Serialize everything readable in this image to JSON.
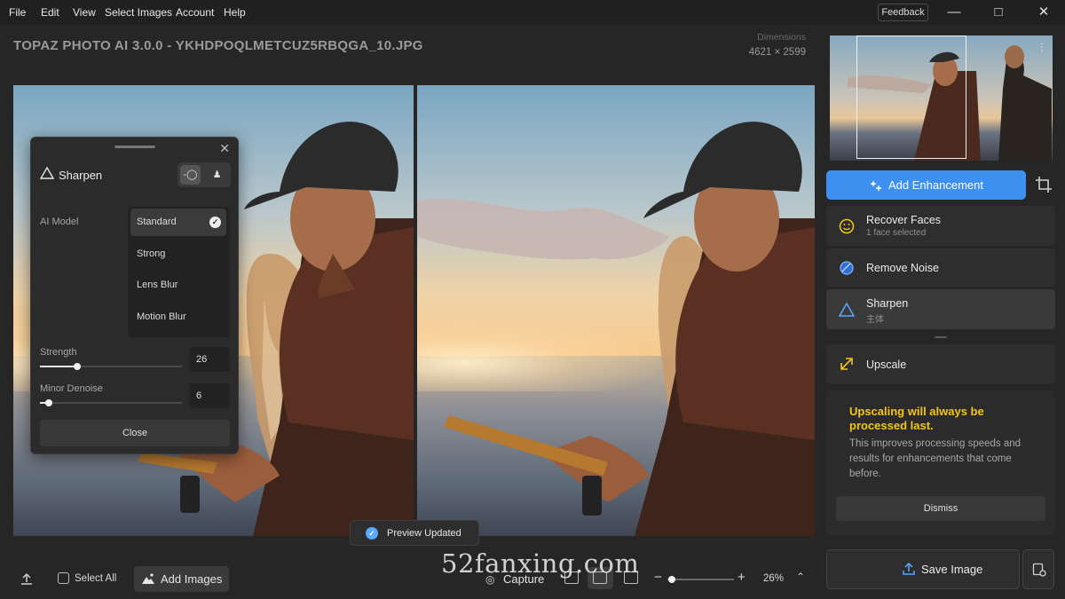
{
  "menu": [
    "File",
    "Edit",
    "View",
    "Select Images",
    "Account",
    "Help"
  ],
  "feedback_label": "Feedback",
  "file_title": "TOPAZ PHOTO AI 3.0.0 - YKHDPOQLMETCUZ5RBQGA_10.JPG",
  "dimensions": {
    "label": "Dimensions",
    "value": "4621 × 2599"
  },
  "sharpen_panel": {
    "title": "Sharpen",
    "ai_model_label": "AI Model",
    "models": [
      "Standard",
      "Strong",
      "Lens Blur",
      "Motion Blur"
    ],
    "selected_model": "Standard",
    "strength": {
      "label": "Strength",
      "value": "26",
      "fraction": 0.26
    },
    "minor_denoise": {
      "label": "Minor Denoise",
      "value": "6",
      "fraction": 0.06
    },
    "close_label": "Close"
  },
  "toast": {
    "text": "Preview Updated"
  },
  "bottom_bar": {
    "select_all": "Select All",
    "add_images": "Add Images",
    "capture": "Capture",
    "zoom": "26%",
    "zoom_fraction": 0.07
  },
  "watermark": "52fanxing.com",
  "sidebar": {
    "add_enhancement": "Add Enhancement",
    "enhancements": [
      {
        "title": "Recover Faces",
        "subtitle": "1 face selected",
        "icon": "smile-icon"
      },
      {
        "title": "Remove Noise",
        "subtitle": "",
        "icon": "noise-icon"
      },
      {
        "title": "Sharpen",
        "subtitle": "主体",
        "icon": "triangle-icon"
      },
      {
        "title": "Upscale",
        "subtitle": "",
        "icon": "upscale-arrow-icon"
      }
    ],
    "upscale_note": {
      "title": "Upscaling will always be processed last.",
      "body": "This improves processing speeds and results for enhancements that come before.",
      "dismiss": "Dismiss"
    },
    "save_image": "Save Image"
  },
  "colors": {
    "accent": "#3d8ff0",
    "warning": "#f5c518",
    "toast_check": "#5aa7ff"
  }
}
